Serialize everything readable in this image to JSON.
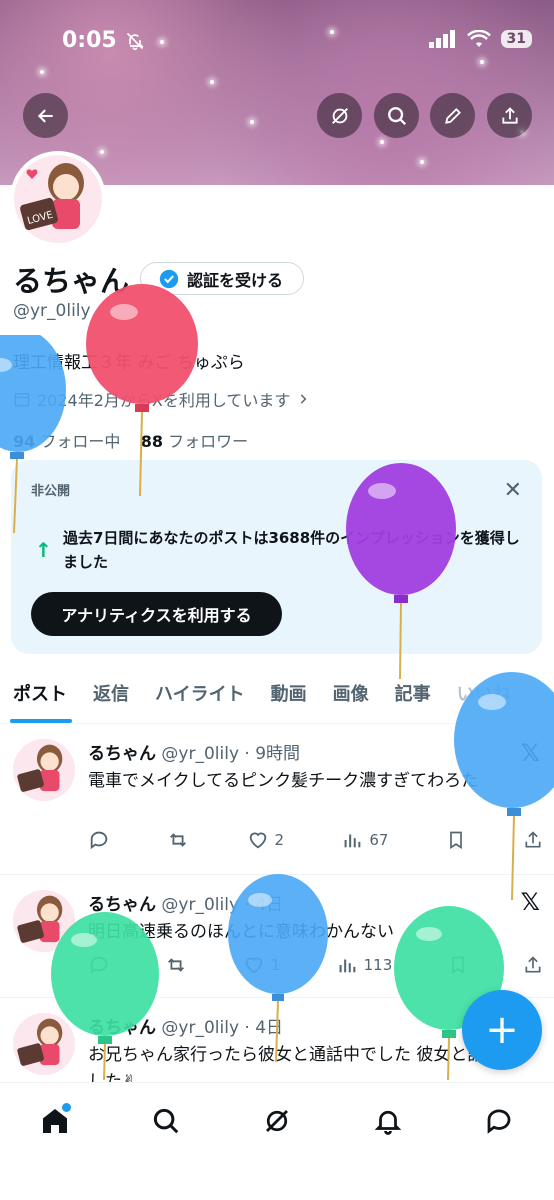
{
  "status": {
    "time": "0:05",
    "battery": "31"
  },
  "profile": {
    "name": "るちゃん",
    "verify_label": "認証を受ける",
    "handle": "@yr_0lily",
    "bio": "理工情報工３年 みご ちゅぷら",
    "joined": "2024年2月からXを利用しています",
    "following_count": "94",
    "following_label": "フォロー中",
    "followers_count": "88",
    "followers_label": "フォロワー"
  },
  "card": {
    "private_label": "非公開",
    "message": "過去7日間にあなたのポストは3688件のインプレッションを獲得しました",
    "button_label": "アナリティクスを利用する"
  },
  "tabs": [
    "ポスト",
    "返信",
    "ハイライト",
    "動画",
    "画像",
    "記事",
    "いいね"
  ],
  "posts": [
    {
      "name": "るちゃん",
      "meta": "@yr_0lily · 9時間",
      "text": "電車でメイクしてるピンク髪チーク濃すぎてわろた",
      "likes": "2",
      "views": "67"
    },
    {
      "name": "るちゃん",
      "meta": "@yr_0lily · 4日",
      "text": "明日高速乗るのほんとに意味わかんない",
      "likes": "1",
      "views": "113"
    },
    {
      "name": "るちゃん",
      "meta": "@yr_0lily · 4日",
      "text": "お兄ちゃん家行ったら彼女と通話中でした 彼女と話しました✌",
      "likes": "",
      "views": ""
    }
  ],
  "avatar_text": "LOVE",
  "colors": {
    "accent": "#1d9bf0",
    "green": "#00ba7c"
  }
}
